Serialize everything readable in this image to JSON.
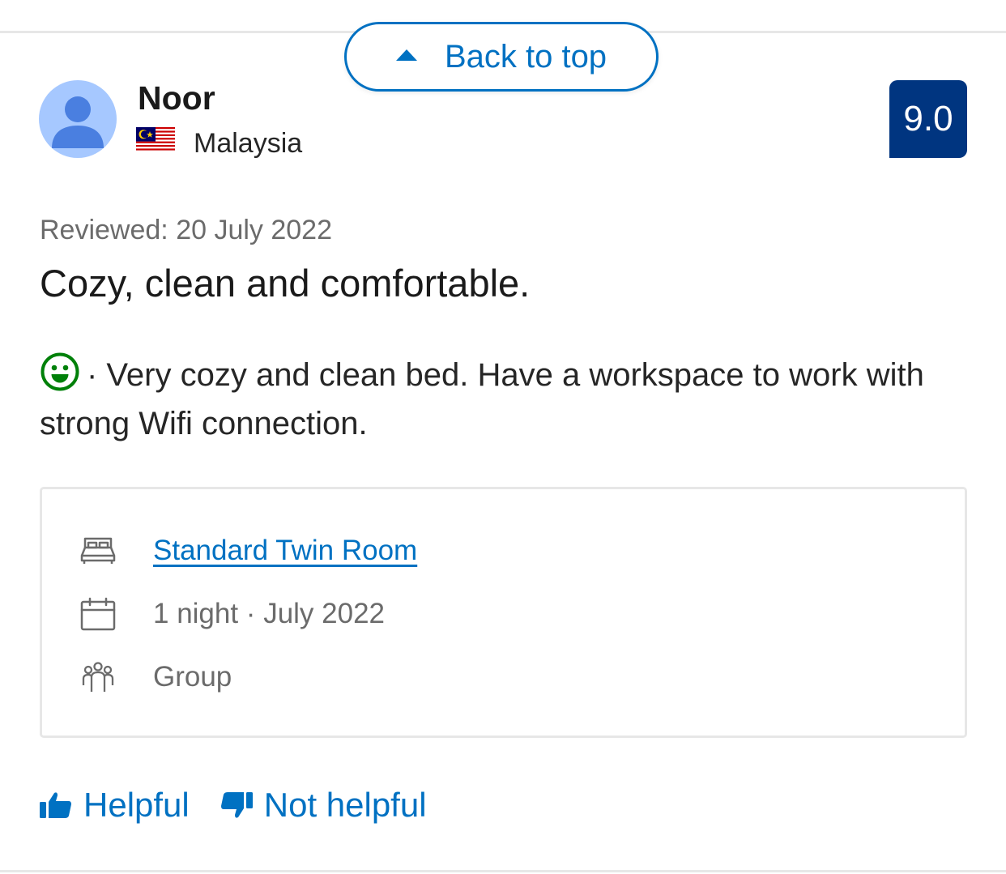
{
  "back_to_top": {
    "label": "Back to top"
  },
  "reviewer": {
    "name": "Noor",
    "country": "Malaysia",
    "flag": "malaysia-flag"
  },
  "score": "9.0",
  "review": {
    "date": "Reviewed: 20 July 2022",
    "title": "Cozy, clean and comfortable.",
    "positive_text": "· Very cozy and clean bed. Have a workspace to work with strong Wifi connection."
  },
  "stay": {
    "room": "Standard Twin Room",
    "duration": "1 night · July 2022",
    "traveler_type": "Group"
  },
  "actions": {
    "helpful": "Helpful",
    "not_helpful": "Not helpful"
  },
  "colors": {
    "link": "#0071c2",
    "score_bg": "#003580",
    "positive": "#008009",
    "avatar_bg": "#a6c8ff",
    "avatar_fg": "#4a7fe0"
  }
}
